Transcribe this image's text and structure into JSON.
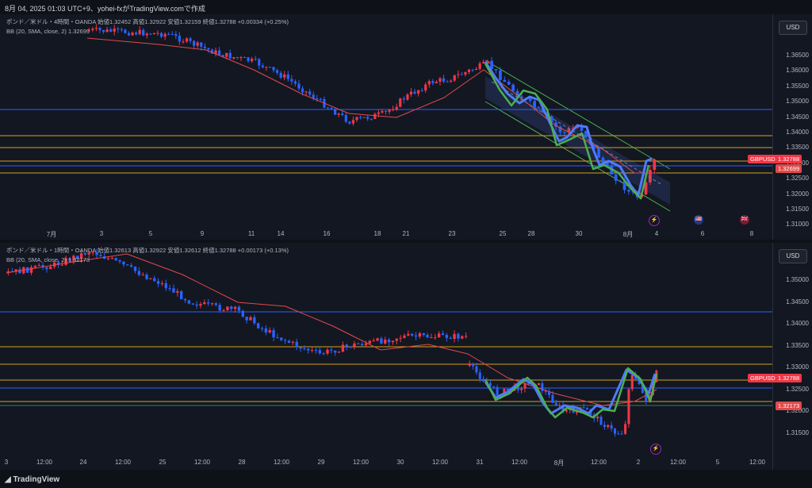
{
  "header": {
    "text": "8月 04, 2025 01:03 UTC+9、yohei-fxがTradingView.comで作成"
  },
  "footer": {
    "brand": "TradingView"
  },
  "colors": {
    "up": "#f23645",
    "down": "#2962ff",
    "bb": "#e04a4a",
    "blue_line": "#2962ff",
    "gold_line": "#d4a017",
    "green_wave": "#4caf50",
    "channel": "#2a3a6b"
  },
  "top_pane": {
    "legend_line1": "ポンド／米ドル・4時間・OANDA  始値1.32452  高値1.32922  安値1.32159  終値1.32788  +0.00334 (+0.25%)",
    "legend_line2": "BB (20, SMA, close, 2)  1.32699",
    "currency": "USD",
    "price_ticks": [
      "1.36500",
      "1.36000",
      "1.35500",
      "1.35000",
      "1.34500",
      "1.34000",
      "1.33500",
      "1.33000",
      "1.32500",
      "1.32000",
      "1.31500",
      "1.31000"
    ],
    "symbol_tag": "GBPUSD",
    "last_price": "1.32788",
    "bb_value": "1.32699",
    "time_labels": [
      "7月",
      "3",
      "5",
      "9",
      "11",
      "14",
      "16",
      "18",
      "21",
      "23",
      "25",
      "28",
      "30",
      "8月",
      "4",
      "6",
      "8"
    ],
    "events": [
      "⚡",
      "🇺🇸",
      "🇬🇧"
    ]
  },
  "bottom_pane": {
    "legend_line1": "ポンド／米ドル・1時間・OANDA  始値1.32613  高値1.32922  安値1.32612  終値1.32788  +0.00173 (+0.13%)",
    "legend_line2": "BB (20, SMA, close, 2)  1.32173",
    "currency": "USD",
    "price_ticks": [
      "1.35000",
      "1.34500",
      "1.34000",
      "1.33500",
      "1.33000",
      "1.32500",
      "1.32000",
      "1.31500"
    ],
    "symbol_tag": "GBPUSD",
    "last_price": "1.32788",
    "bb_value": "1.32173",
    "time_labels": [
      "3",
      "12:00",
      "24",
      "12:00",
      "25",
      "12:00",
      "28",
      "12:00",
      "29",
      "12:00",
      "30",
      "12:00",
      "31",
      "12:00",
      "8月",
      "12:00",
      "2",
      "12:00",
      "5",
      "12:00"
    ],
    "events": [
      "⚡"
    ]
  }
}
